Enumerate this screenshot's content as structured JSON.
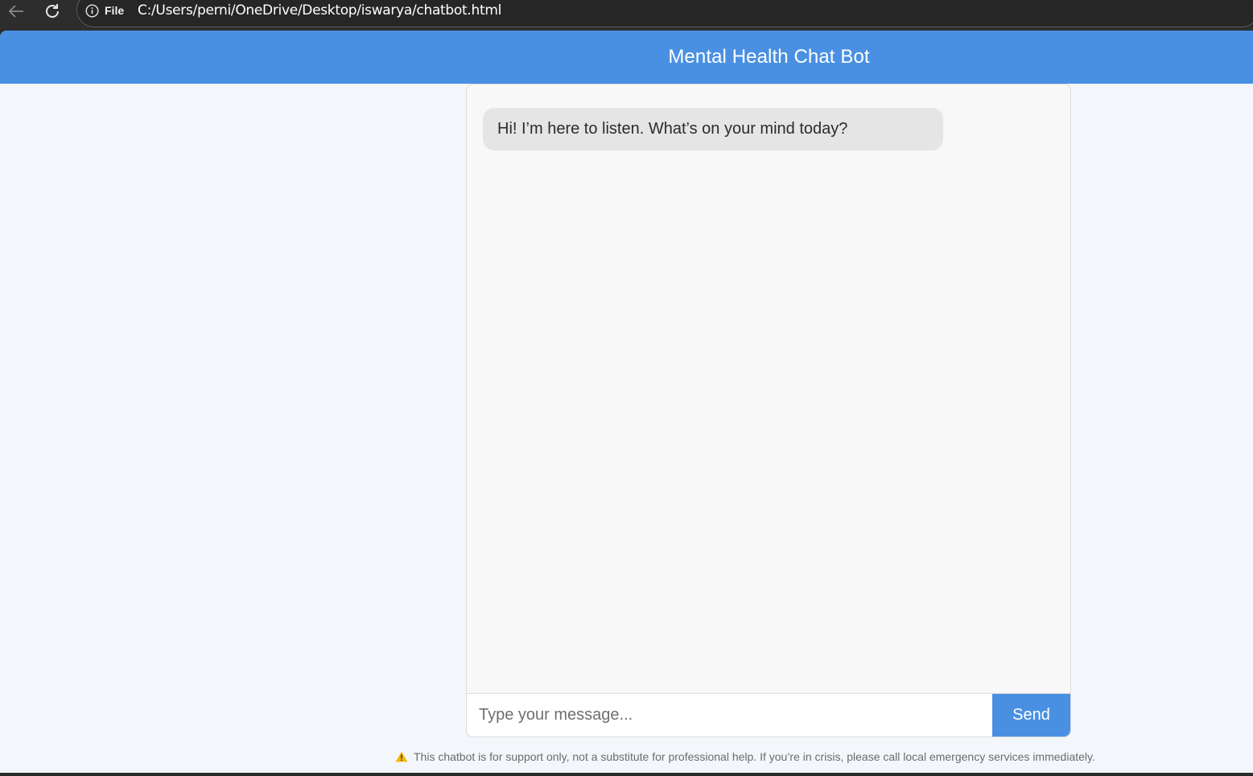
{
  "browser": {
    "scheme_label": "File",
    "url": "C:/Users/perni/OneDrive/Desktop/iswarya/chatbot.html"
  },
  "app": {
    "title": "Mental Health Chat Bot",
    "accent_color": "#4a90e2"
  },
  "chat": {
    "messages": [
      {
        "sender": "bot",
        "text": "Hi! I’m here to listen. What’s on your mind today?"
      }
    ]
  },
  "composer": {
    "placeholder": "Type your message...",
    "value": "",
    "send_label": "Send"
  },
  "footer": {
    "icon": "warning-icon",
    "disclaimer": "This chatbot is for support only, not a substitute for professional help. If you’re in crisis, please call local emergency services immediately."
  }
}
